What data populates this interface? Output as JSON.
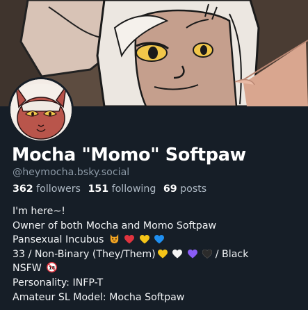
{
  "profile": {
    "display_name": "Mocha \"Momo\" Softpaw",
    "handle": "@heymocha.bsky.social",
    "stats": {
      "followers_count": "362",
      "followers_label": "followers",
      "following_count": "151",
      "following_label": "following",
      "posts_count": "69",
      "posts_label": "posts"
    },
    "bio": [
      {
        "text": "I'm here~!",
        "emoji": []
      },
      {
        "text": "Owner of both Mocha and Momo Softpaw",
        "emoji": []
      },
      {
        "text": "Pansexual Incubus",
        "emoji": [
          "demon-cat-face-icon",
          "red-heart-icon",
          "yellow-heart-icon",
          "blue-heart-icon"
        ]
      },
      {
        "text": "33 / Non-Binary (They/Them)",
        "emoji": [
          "yellow-heart-icon",
          "white-heart-icon",
          "purple-heart-icon",
          "black-heart-icon"
        ],
        "suffix": "/ Black"
      },
      {
        "text": "NSFW",
        "emoji": [
          "no-one-under-18-icon"
        ]
      },
      {
        "text": "Personality: INFP-T",
        "emoji": []
      },
      {
        "text": "Amateur SL Model: Mocha Softpaw",
        "emoji": []
      }
    ]
  },
  "colors": {
    "background": "#161e27",
    "handle": "#8b98a5",
    "heart_red": "#e0343f",
    "heart_yellow": "#f5c518",
    "heart_blue": "#1f8ff0",
    "heart_white": "#f4f4f4",
    "heart_purple": "#8a5cf6",
    "heart_black": "#2b2b2b"
  }
}
